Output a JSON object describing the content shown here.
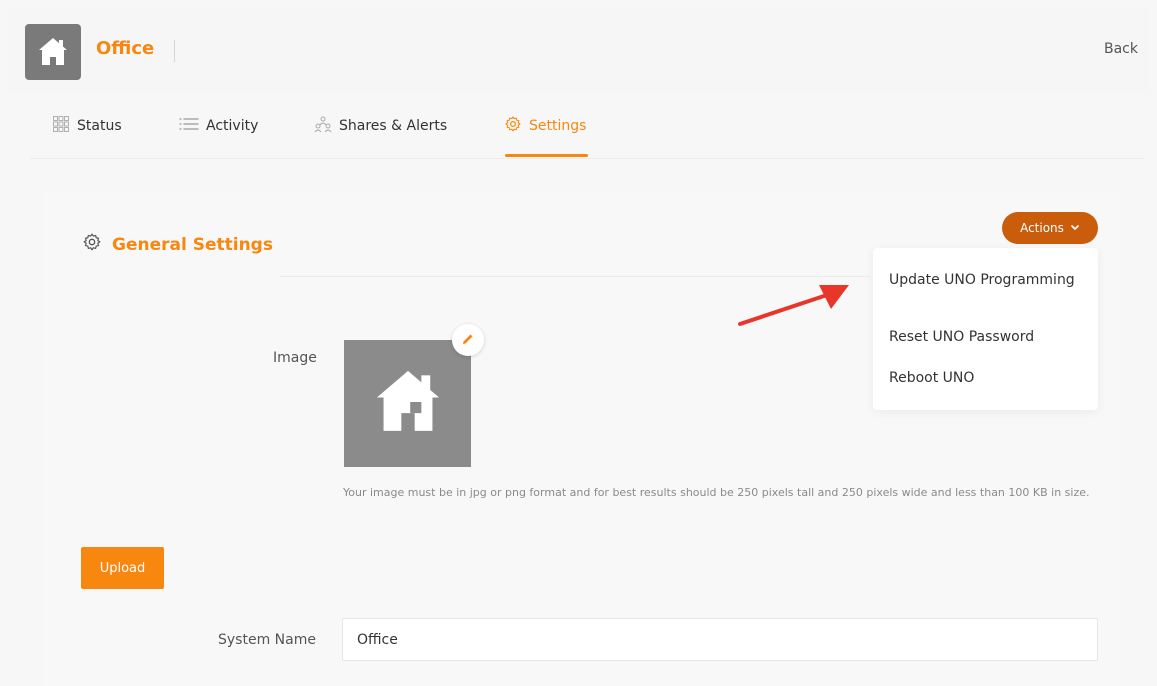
{
  "header": {
    "title": "Office",
    "back_label": "Back",
    "logo_icon": "house-icon"
  },
  "tabs": [
    {
      "label": "Status",
      "icon": "grid-icon"
    },
    {
      "label": "Activity",
      "icon": "list-icon"
    },
    {
      "label": "Shares & Alerts",
      "icon": "users-icon"
    },
    {
      "label": "Settings",
      "icon": "gear-icon",
      "active": true
    }
  ],
  "section": {
    "title": "General Settings",
    "icon": "gear-icon"
  },
  "actions": {
    "label": "Actions",
    "items": [
      {
        "label": "Update UNO Programming"
      },
      {
        "label": "Reset UNO Password"
      },
      {
        "label": "Reboot UNO"
      }
    ]
  },
  "form": {
    "image_label": "Image",
    "image_help": "Your image must be in jpg or png format and for best results should be 250 pixels tall and 250 pixels wide and less than 100 KB in size.",
    "upload_label": "Upload",
    "system_name_label": "System Name",
    "system_name_value": "Office"
  },
  "colors": {
    "accent": "#f7870f",
    "actions_button": "#c95d0c",
    "annotation_arrow": "#e8372a"
  }
}
